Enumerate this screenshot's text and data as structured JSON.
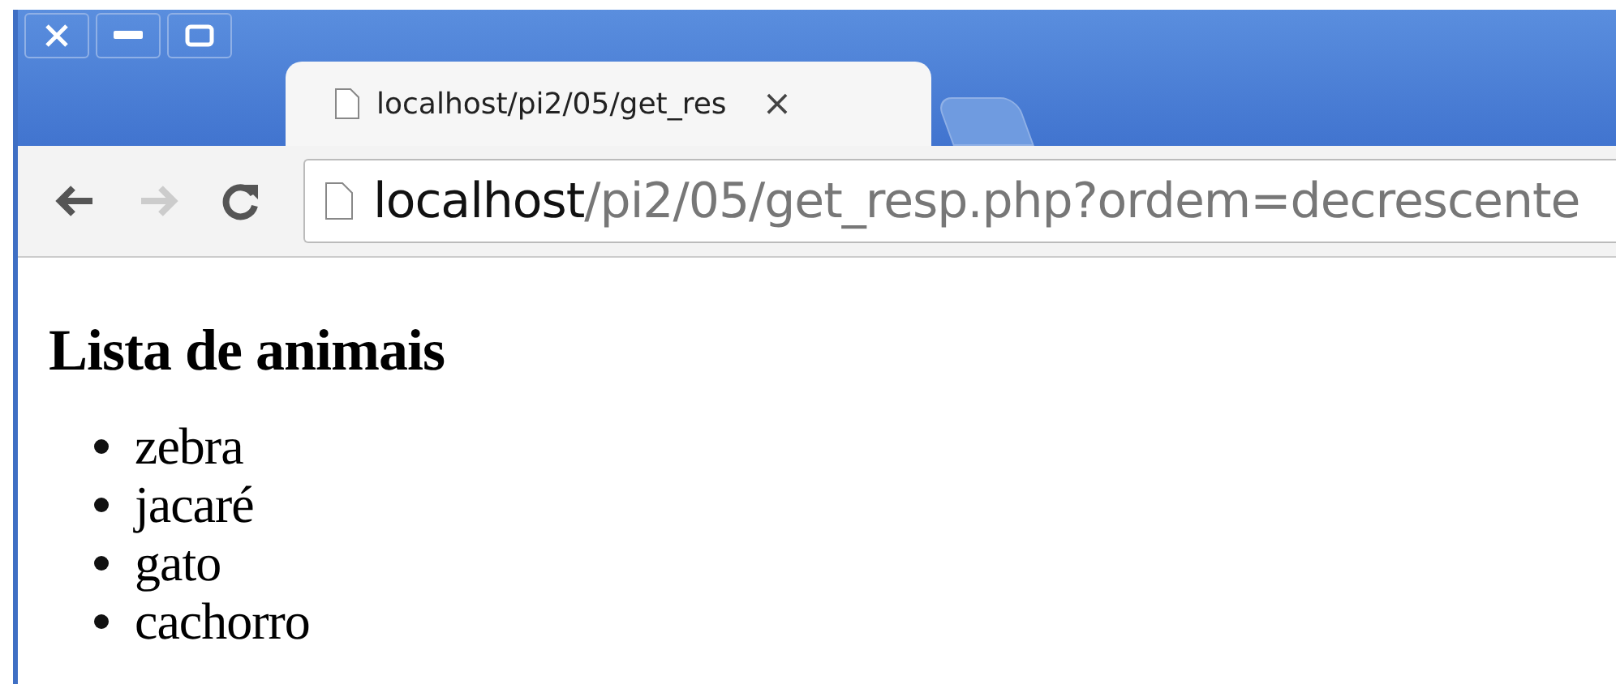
{
  "tabs": [
    {
      "title": "localhost/pi2/05/get_res",
      "close": "×",
      "selected": true
    },
    {
      "selected": false
    }
  ],
  "address": {
    "host": "localhost",
    "path": "/pi2/05/get_resp.php?ordem=decrescente"
  },
  "nav": {
    "back_disabled": false,
    "forward_disabled": true
  },
  "page": {
    "heading": "Lista de animais",
    "items": [
      "zebra",
      "jacaré",
      "gato",
      "cachorro"
    ]
  }
}
